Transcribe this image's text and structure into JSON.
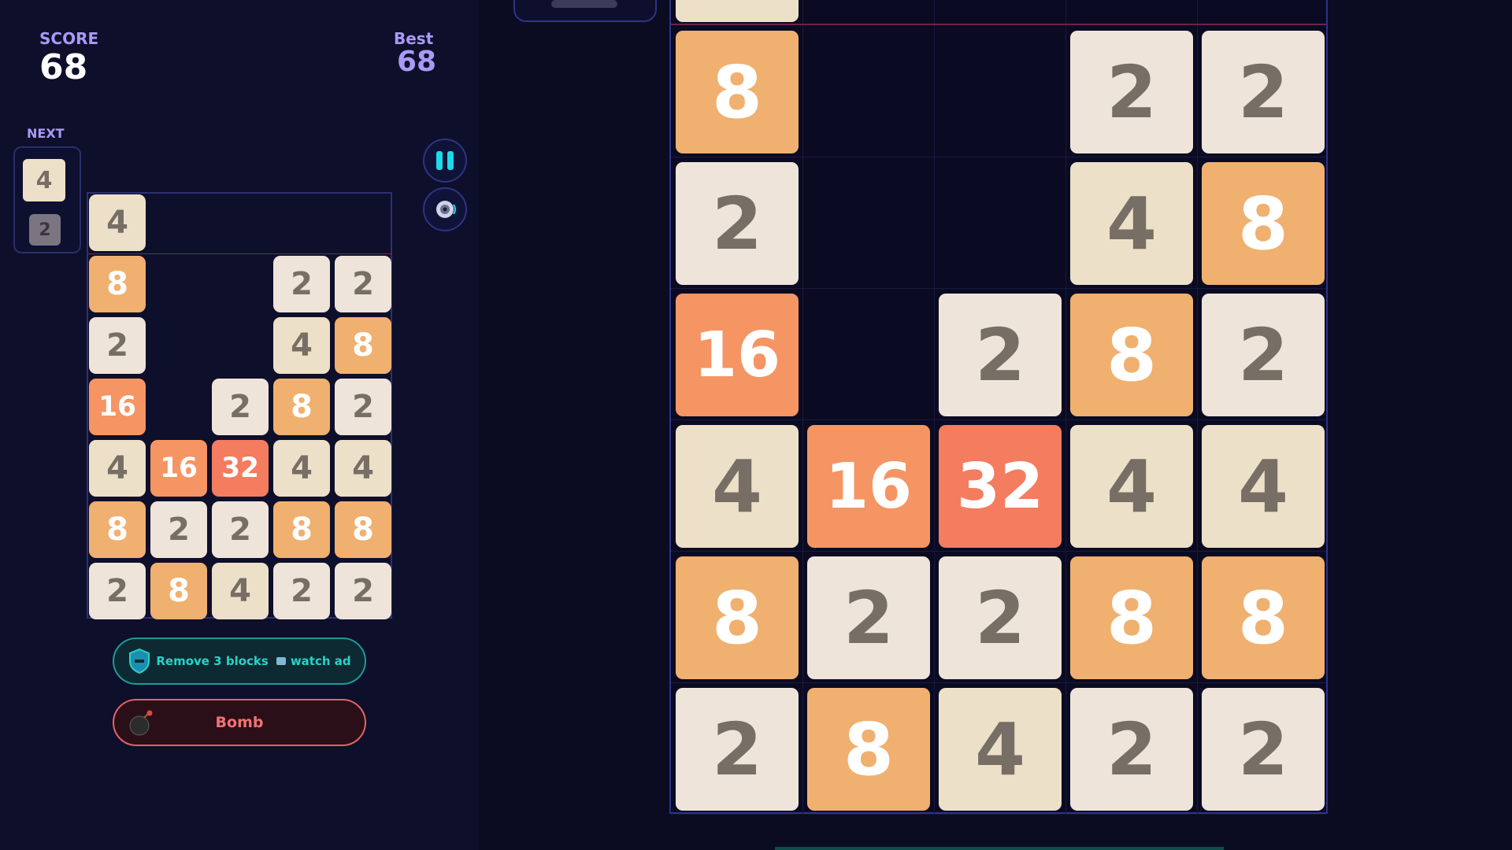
{
  "hud": {
    "score_label": "SCORE",
    "score": "68",
    "best_label": "Best",
    "best": "68",
    "next_label": "NEXT"
  },
  "next_tiles": [
    "4",
    "2"
  ],
  "board": [
    [
      "4",
      "",
      "",
      "",
      ""
    ],
    [
      "8",
      "",
      "",
      "2",
      "2"
    ],
    [
      "2",
      "",
      "",
      "4",
      "8"
    ],
    [
      "16",
      "",
      "2",
      "8",
      "2"
    ],
    [
      "4",
      "16",
      "32",
      "4",
      "4"
    ],
    [
      "8",
      "2",
      "2",
      "8",
      "8"
    ],
    [
      "2",
      "8",
      "4",
      "2",
      "2"
    ]
  ],
  "buttons": {
    "remove_label": "Remove 3 blocks",
    "watch_ad_label": "watch ad",
    "bomb_label": "Bomb"
  },
  "icons": {
    "pause": "pause-icon",
    "sound": "speaker-icon",
    "shield": "shield-icon",
    "bomb": "bomb-icon",
    "video": "video-icon"
  },
  "colors": {
    "background": "#0b0c22",
    "accent_purple": "#a89af6",
    "accent_teal": "#27d3c8",
    "bomb_red": "#f07272",
    "tile_2": "#eee4da",
    "tile_4": "#ede0c8",
    "tile_8": "#f0b070",
    "tile_16": "#f59563",
    "tile_32": "#f47c5f",
    "next_tile_dim": "#7a7580"
  }
}
